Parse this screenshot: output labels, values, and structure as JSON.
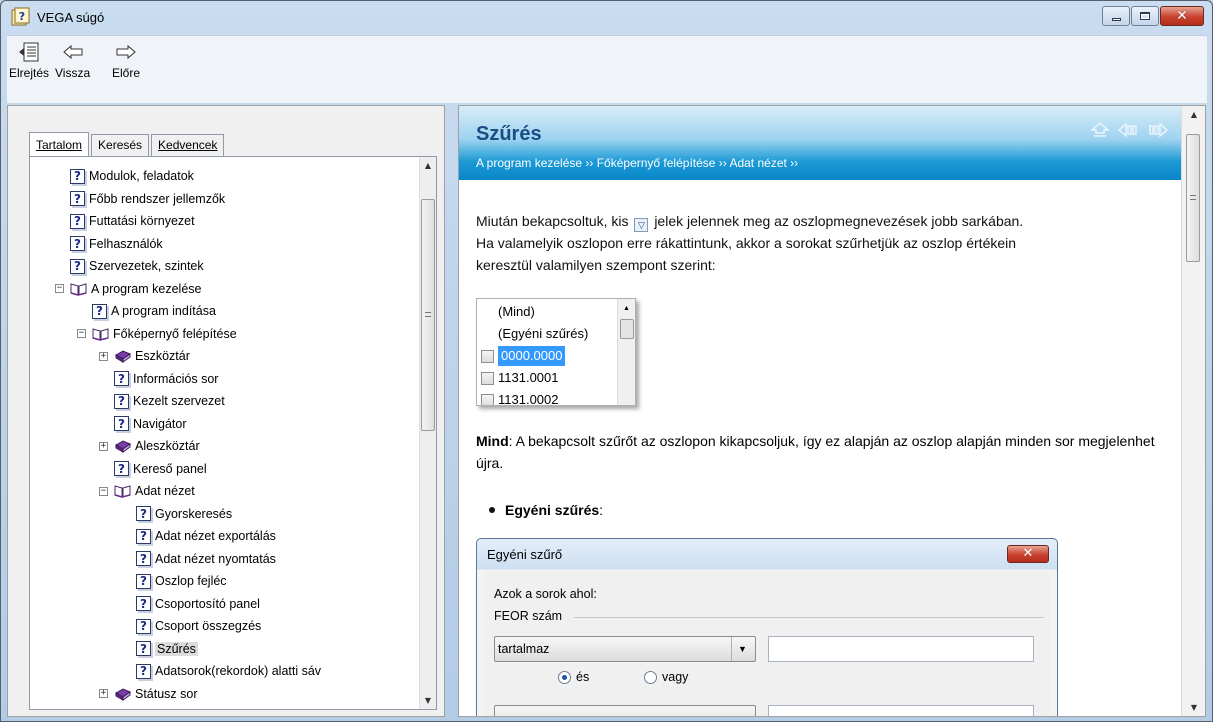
{
  "window": {
    "title": "VEGA súgó",
    "buttons": {
      "minimize": "–",
      "maximize": "□",
      "close": "✕"
    }
  },
  "toolbar": {
    "hide_label": "Elrejtés",
    "back_label": "Vissza",
    "forward_label": "Előre"
  },
  "tabs": [
    {
      "label": "Tartalom",
      "active": true
    },
    {
      "label": "Keresés",
      "active": false
    },
    {
      "label": "Kedvencek",
      "active": false
    }
  ],
  "tree": [
    {
      "label": "Modulok, feladatok",
      "level": 0,
      "type": "page"
    },
    {
      "label": "Főbb rendszer jellemzők",
      "level": 0,
      "type": "page"
    },
    {
      "label": "Futtatási környezet",
      "level": 0,
      "type": "page"
    },
    {
      "label": "Felhasználók",
      "level": 0,
      "type": "page"
    },
    {
      "label": "Szervezetek, szintek",
      "level": 0,
      "type": "page"
    },
    {
      "label": "A program kezelése",
      "level": 0,
      "type": "book-open",
      "expander": "−"
    },
    {
      "label": "A program indítása",
      "level": 1,
      "type": "page"
    },
    {
      "label": "Főképernyő felépítése",
      "level": 1,
      "type": "book-open",
      "expander": "−"
    },
    {
      "label": "Eszköztár",
      "level": 2,
      "type": "book-closed",
      "expander": "+"
    },
    {
      "label": "Információs sor",
      "level": 2,
      "type": "page"
    },
    {
      "label": "Kezelt szervezet",
      "level": 2,
      "type": "page"
    },
    {
      "label": "Navigátor",
      "level": 2,
      "type": "page"
    },
    {
      "label": "Aleszköztár",
      "level": 2,
      "type": "book-closed",
      "expander": "+"
    },
    {
      "label": "Kereső panel",
      "level": 2,
      "type": "page"
    },
    {
      "label": "Adat nézet",
      "level": 2,
      "type": "book-open",
      "expander": "−"
    },
    {
      "label": "Gyorskeresés",
      "level": 3,
      "type": "page"
    },
    {
      "label": "Adat nézet exportálás",
      "level": 3,
      "type": "page"
    },
    {
      "label": "Adat nézet nyomtatás",
      "level": 3,
      "type": "page"
    },
    {
      "label": "Oszlop fejléc",
      "level": 3,
      "type": "page"
    },
    {
      "label": "Csoportosító panel",
      "level": 3,
      "type": "page"
    },
    {
      "label": "Csoport összegzés",
      "level": 3,
      "type": "page"
    },
    {
      "label": "Szűrés",
      "level": 3,
      "type": "page",
      "selected": true
    },
    {
      "label": "Adatsorok(rekordok) alatti sáv",
      "level": 3,
      "type": "page"
    },
    {
      "label": "Státusz sor",
      "level": 2,
      "type": "book-closed",
      "expander": "+"
    }
  ],
  "article": {
    "title": "Szűrés",
    "breadcrumb": "A program kezelése ›› Főképernyő felépítése ›› Adat nézet ››",
    "intro_part1": "Miután bekapcsoltuk, kis",
    "intro_part2": "jelek jelennek meg az oszlopmegnevezések jobb sarkában.",
    "intro_line2": "Ha valamelyik oszlopon erre rákattintunk, akkor a sorokat szűrhetjük az oszlop értékein",
    "intro_line3": "keresztül valamilyen szempont szerint:",
    "filter_items": [
      {
        "text": "(Mind)",
        "checkbox": false,
        "selected": false
      },
      {
        "text": "(Egyéni szűrés)",
        "checkbox": false,
        "selected": false
      },
      {
        "text": "0000.0000",
        "checkbox": true,
        "selected": true
      },
      {
        "text": "1131.0001",
        "checkbox": true,
        "selected": false
      },
      {
        "text": "1131.0002",
        "checkbox": true,
        "selected": false
      }
    ],
    "mind_bold": "Mind",
    "mind_text": ": A bekapcsolt szűrőt az oszlopon kikapcsoljuk, így ez alapján az oszlop alapján minden sor megjelenhet újra.",
    "bullet_bold": "Egyéni szűrés",
    "bullet_colon": ":"
  },
  "dialog": {
    "title": "Egyéni szűrő",
    "close": "✕",
    "rows_label": "Azok a sorok ahol:",
    "field_label": "FEOR szám",
    "operator_value": "tartalmaz",
    "operator_arrow": "▼",
    "radio_and": "és",
    "radio_or": "vagy"
  },
  "scroll_arrows": {
    "up": "▲",
    "down": "▼"
  }
}
